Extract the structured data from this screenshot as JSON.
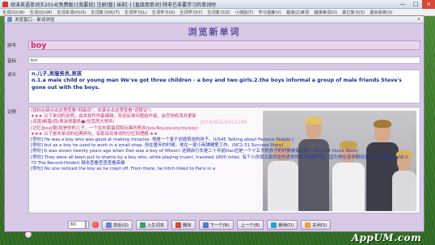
{
  "app": {
    "title": "琼沫英语单词王2014[免费版]·[我要说] 注册[暂] 当前[·] [直接用单词] 除非已非要学习的单词时",
    "menu": [
      "生词(Q)(W)",
      "生词(Q)(W)",
      "生词本词(H)(S)",
      "生词复习(R)(T)",
      "生词学习(L)",
      "生词学习(U)",
      "生词学习(Y)",
      "生词复习(Z)",
      "小测验(T)",
      "学习进度(V)",
      "错误(Z)单词",
      "错误单词(O)",
      "其它复习(S)",
      "退出系统(X)"
    ],
    "close_label": "×",
    "max_label": "□",
    "min_label": "—"
  },
  "dialog": {
    "title": "浏览窗口 - 新词浏览",
    "close_label": "×",
    "heading": "浏览新单词",
    "labels": {
      "word": "拼写",
      "raw": "音标",
      "meaning": "词义",
      "example": "记例"
    },
    "word": "boy",
    "raw": "bɔi",
    "meaning": "n.儿子,男服务员,男孩\nn.1.a male child or young man We've got three children - a boy and two girls.2.the boys informal a group of male friends Steve's gone out with the boys.",
    "watermark": "JSY-ENGLISH.COM",
    "examples": [
      {
        "cls": "cn",
        "text": "(如标在键点击这里查看\"网最词\"，右键点击这里查看\"词根记\")"
      },
      {
        "cls": "sec",
        "text": "★★★ 以下单词的说明，由本软件作者编辑，欢迎反馈问题给作者，会尽快修改并更新"
      },
      {
        "cls": "cn",
        "text": "[词源]希腊(西)男孩男服务●(炊其两大喷辛)"
      },
      {
        "cls": "cn",
        "text": "[记忆]boy[服]就是你的儿子，一个在你家最调和玩具的男孩(boy.Roy.joy.soy.toy.boy)"
      },
      {
        "cls": "sec",
        "text": "★★★ 以下是本单词的经典例句，有助深化单词的记忆和理解 ★★"
      },
      {
        "cls": "en",
        "text": "[例句] He was a boy who was good at making miracles. 他是一个善于创造奇迹的孩子。(US45 Talking about Famous People.)"
      },
      {
        "cls": "en",
        "text": "[例句] but as a boy he used to work in a small shop. 但在童年的时候，他在一家小商铺辅里工作。(NC2-31 Success Story)"
      },
      {
        "cls": "en",
        "text": "[例句] It was stolen twenty years ago when Dan was a boy of fifteen! 这辆自行车是二十年前Dan还是一个十五岁的孩子的时候被偷走的！(NC2-34 Quick Work)"
      },
      {
        "cls": "en",
        "text": "[例句] They were all been put to shame by a boy who, while playing truant, traveled 1600 miles. 有个小孩使大家的这些逃学的孩子自愧不如，因为他在逃学期间旅行1600英里。(NC2-73 The Record-Holder) 键击查看查查查看英雄"
      },
      {
        "cls": "en",
        "text": "[例句] No one noticed the boy as he crept off. From there, he hitch-hiked to Paris in a"
      }
    ]
  },
  "toolbar": {
    "count_value": "60",
    "buttons": [
      {
        "name": "prev-button",
        "label": "前后(G)"
      },
      {
        "name": "add-word-button",
        "label": "入生词本"
      },
      {
        "name": "delete-button",
        "label": "删除"
      },
      {
        "name": "next-button",
        "label": "下一个(N)"
      },
      {
        "name": "prev-one-button",
        "label": "上一个(B)"
      },
      {
        "name": "read-button",
        "label": "朗读(D)"
      },
      {
        "name": "close-button",
        "label": "关闭(S)"
      }
    ]
  },
  "logo": "AppUM.com",
  "colors": {
    "dialog_bg": "#d7c9e6",
    "heading": "#5a4b9a",
    "word_text": "#d7276a",
    "meaning_text": "#1a2c8c"
  }
}
